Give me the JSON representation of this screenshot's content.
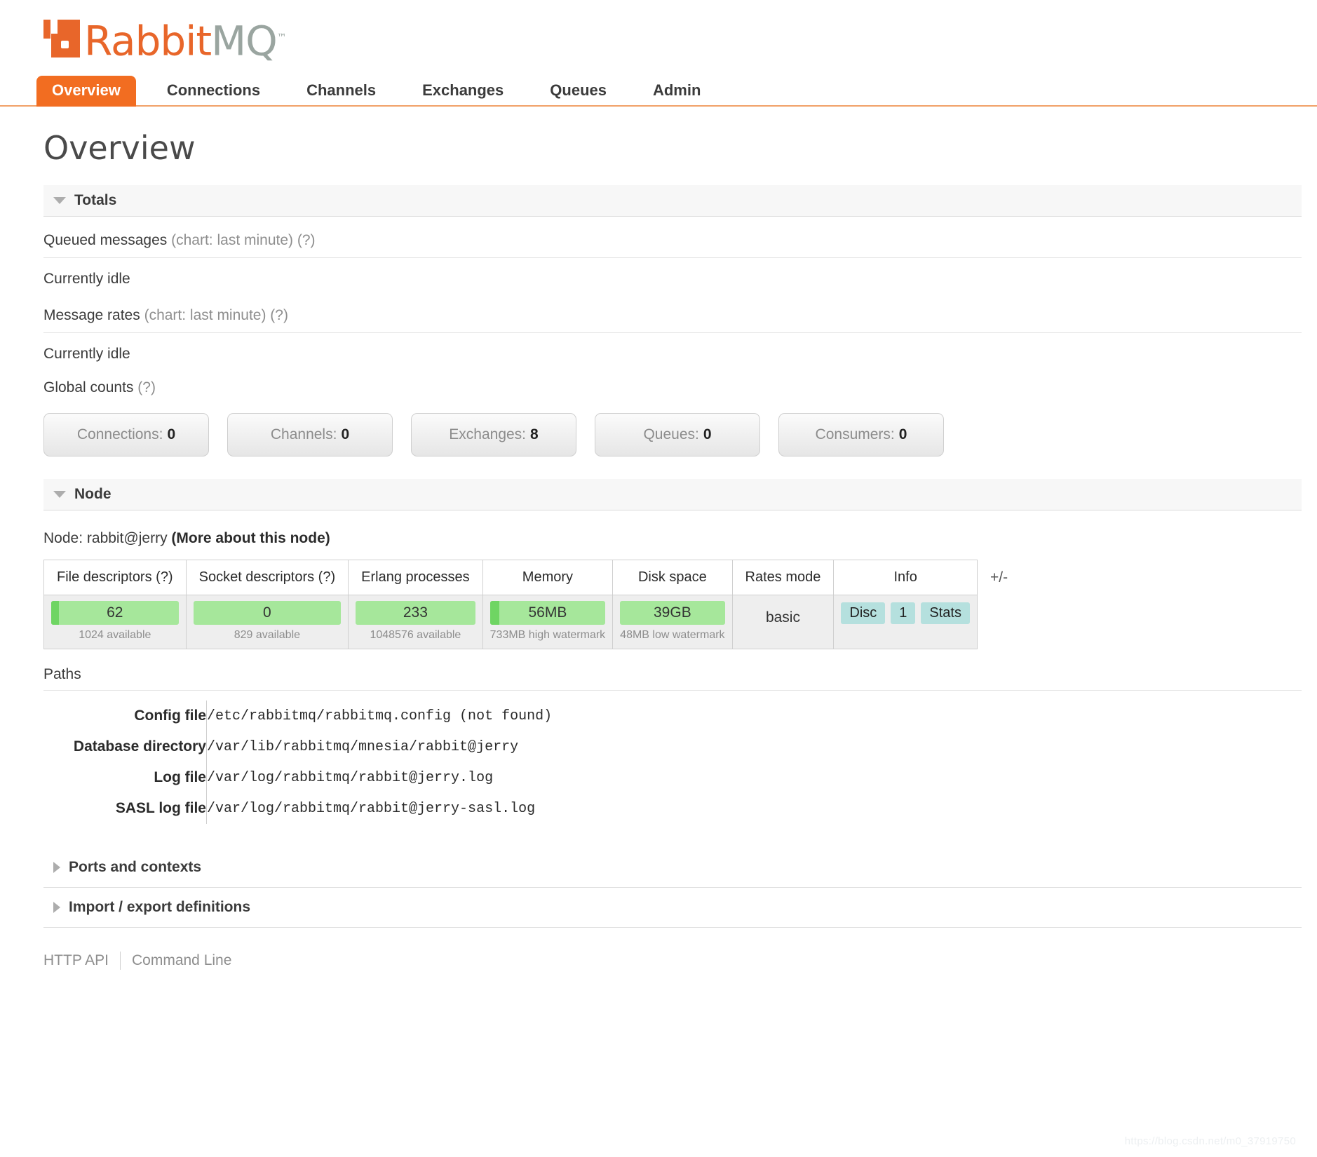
{
  "brand": {
    "name_part1": "Rabbit",
    "name_part2": "MQ",
    "trademark": "™",
    "accent_color": "#f26d21",
    "secondary_color": "#9aa5a0"
  },
  "nav": {
    "items": [
      {
        "label": "Overview",
        "active": true
      },
      {
        "label": "Connections",
        "active": false
      },
      {
        "label": "Channels",
        "active": false
      },
      {
        "label": "Exchanges",
        "active": false
      },
      {
        "label": "Queues",
        "active": false
      },
      {
        "label": "Admin",
        "active": false
      }
    ]
  },
  "page": {
    "title": "Overview"
  },
  "totals": {
    "section_title": "Totals",
    "queued_messages_label": "Queued messages",
    "queued_messages_note": "(chart: last minute) (?)",
    "queued_messages_status": "Currently idle",
    "message_rates_label": "Message rates",
    "message_rates_note": "(chart: last minute) (?)",
    "message_rates_status": "Currently idle",
    "global_counts_label": "Global counts",
    "global_counts_note": "(?)",
    "counts": [
      {
        "label": "Connections:",
        "value": "0"
      },
      {
        "label": "Channels:",
        "value": "0"
      },
      {
        "label": "Exchanges:",
        "value": "8"
      },
      {
        "label": "Queues:",
        "value": "0"
      },
      {
        "label": "Consumers:",
        "value": "0"
      }
    ]
  },
  "node": {
    "section_title": "Node",
    "node_prefix": "Node:",
    "node_name": "rabbit@jerry",
    "more_link": "(More about this node)",
    "plus_minus": "+/-",
    "columns": [
      "File descriptors (?)",
      "Socket descriptors (?)",
      "Erlang processes",
      "Memory",
      "Disk space",
      "Rates mode",
      "Info"
    ],
    "cells": [
      {
        "type": "gauge",
        "value": "62",
        "sub": "1024 available",
        "fill_pct": 6
      },
      {
        "type": "gauge",
        "value": "0",
        "sub": "829 available",
        "fill_pct": 0
      },
      {
        "type": "gauge",
        "value": "233",
        "sub": "1048576 available",
        "fill_pct": 0
      },
      {
        "type": "gauge",
        "value": "56MB",
        "sub": "733MB high watermark",
        "fill_pct": 8
      },
      {
        "type": "gauge",
        "value": "39GB",
        "sub": "48MB low watermark",
        "fill_pct": 0
      },
      {
        "type": "text",
        "value": "basic"
      },
      {
        "type": "badges",
        "badges": [
          "Disc",
          "1",
          "Stats"
        ]
      }
    ]
  },
  "paths": {
    "label": "Paths",
    "rows": [
      {
        "key": "Config file",
        "value": "/etc/rabbitmq/rabbitmq.config (not found)"
      },
      {
        "key": "Database directory",
        "value": "/var/lib/rabbitmq/mnesia/rabbit@jerry"
      },
      {
        "key": "Log file",
        "value": "/var/log/rabbitmq/rabbit@jerry.log"
      },
      {
        "key": "SASL log file",
        "value": "/var/log/rabbitmq/rabbit@jerry-sasl.log"
      }
    ]
  },
  "collapsed_sections": [
    {
      "label": "Ports and contexts"
    },
    {
      "label": "Import / export definitions"
    }
  ],
  "footer": {
    "http_api": "HTTP API",
    "command_line": "Command Line"
  },
  "watermark": "https://blog.csdn.net/m0_37919750"
}
